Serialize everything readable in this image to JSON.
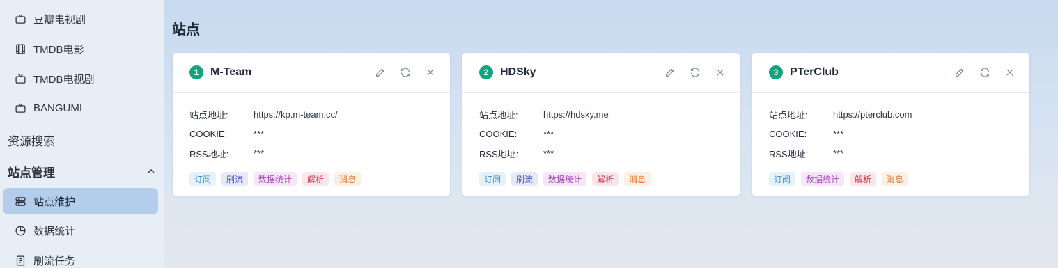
{
  "sidebar": {
    "items_top": [
      {
        "label": "豆瓣电视剧",
        "icon": "tv-icon"
      },
      {
        "label": "TMDB电影",
        "icon": "film-icon"
      },
      {
        "label": "TMDB电视剧",
        "icon": "tv-icon"
      },
      {
        "label": "BANGUMI",
        "icon": "tv-icon"
      }
    ],
    "group_search": "资源搜索",
    "group_sites": "站点管理",
    "items_sites": [
      {
        "label": "站点维护",
        "icon": "server-icon",
        "active": true
      },
      {
        "label": "数据统计",
        "icon": "pie-chart-icon"
      },
      {
        "label": "刷流任务",
        "icon": "task-icon"
      }
    ]
  },
  "main": {
    "title": "站点",
    "sites": [
      {
        "index": "1",
        "name": "M-Team",
        "address_label": "站点地址:",
        "address": "https://kp.m-team.cc/",
        "cookie_label": "COOKIE:",
        "cookie": "***",
        "rss_label": "RSS地址:",
        "rss": "***",
        "tags": [
          "订阅",
          "刷流",
          "数据统计",
          "解析",
          "消息"
        ]
      },
      {
        "index": "2",
        "name": "HDSky",
        "address_label": "站点地址:",
        "address": "https://hdsky.me",
        "cookie_label": "COOKIE:",
        "cookie": "***",
        "rss_label": "RSS地址:",
        "rss": "***",
        "tags": [
          "订阅",
          "刷流",
          "数据统计",
          "解析",
          "消息"
        ]
      },
      {
        "index": "3",
        "name": "PTerClub",
        "address_label": "站点地址:",
        "address": "https://pterclub.com",
        "cookie_label": "COOKIE:",
        "cookie": "***",
        "rss_label": "RSS地址:",
        "rss": "***",
        "tags": [
          "订阅",
          "数据统计",
          "解析",
          "消息"
        ]
      }
    ]
  },
  "colors": {
    "accent": "#14a37f",
    "active_nav": "#b4cdeb",
    "tag_subscribe": "#3b8ed3",
    "tag_brush": "#4a55c9",
    "tag_stats": "#a545b5",
    "tag_parse": "#d4304f",
    "tag_message": "#e0782d"
  }
}
